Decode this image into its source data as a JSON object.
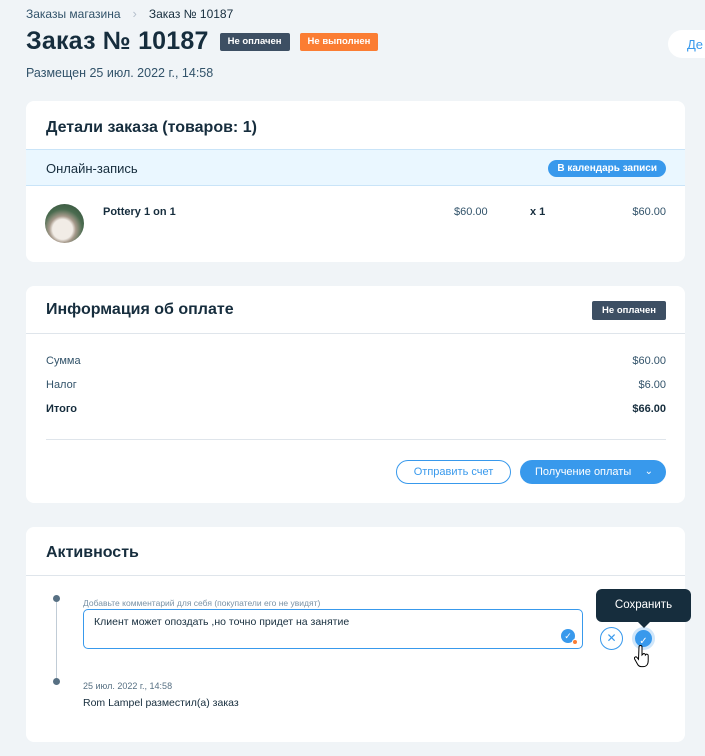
{
  "breadcrumb": {
    "parent": "Заказы магазина",
    "separator": "›",
    "current": "Заказ № 10187"
  },
  "header": {
    "title": "Заказ № 10187",
    "payment_badge": "Не оплачен",
    "fulfillment_badge": "Не выполнен",
    "placed": "Размещен 25 июл. 2022 г., 14:58",
    "edge_button": "Де"
  },
  "order_details": {
    "title": "Детали заказа (товаров: 1)",
    "booking_label": "Онлайн-запись",
    "calendar_button": "В календарь записи",
    "items": [
      {
        "name": "Pottery 1 on 1",
        "price": "$60.00",
        "qty": "x 1",
        "total": "$60.00"
      }
    ]
  },
  "payment": {
    "title": "Информация об оплате",
    "status_badge": "Не оплачен",
    "rows": [
      {
        "label": "Сумма",
        "value": "$60.00"
      },
      {
        "label": "Налог",
        "value": "$6.00"
      },
      {
        "label": "Итого",
        "value": "$66.00"
      }
    ],
    "send_invoice_button": "Отправить счет",
    "collect_payment_button": "Получение оплаты"
  },
  "activity": {
    "title": "Активность",
    "comment_hint": "Добавьте комментарий для себя (покупатели его не увидят)",
    "comment_value": "Клиент может опоздать ,но точно придет на занятие",
    "save_tooltip": "Сохранить",
    "event_time": "25 июл. 2022 г., 14:58",
    "event_text": "Rom Lampel разместил(а) заказ"
  },
  "colors": {
    "accent": "#3899ec",
    "dark_badge": "#3d4f63",
    "orange_badge": "#fb7d33",
    "page_bg": "#f0f4f7"
  },
  "icons": [
    "chevron-right-icon",
    "chevron-down-icon",
    "close-icon",
    "check-icon",
    "grammar-check-icon",
    "hand-cursor-icon"
  ]
}
